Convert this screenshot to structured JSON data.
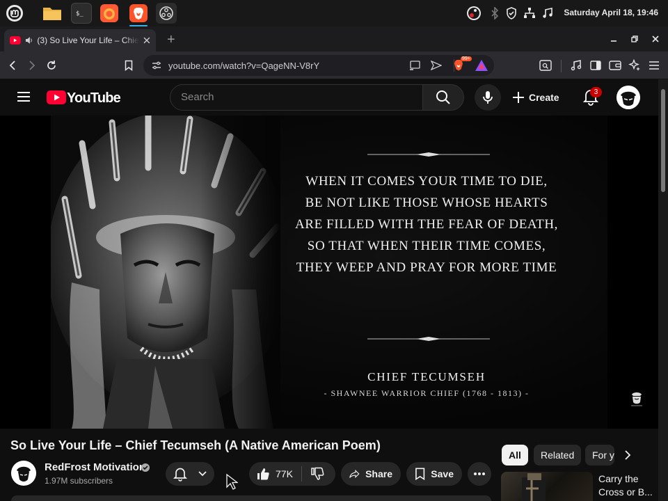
{
  "system_panel": {
    "clock": "Saturday April 18, 19:46",
    "dock_apps": [
      "mint-menu",
      "files",
      "terminal",
      "firefox",
      "brave",
      "obs"
    ]
  },
  "tab": {
    "title": "(3) So Live Your Life – Chief Tecumseh (A Native American Poem)",
    "new_tab": "+"
  },
  "toolbar": {
    "url": "youtube.com/watch?v=QageNN-V8rY",
    "brave_shield_count": "99+"
  },
  "youtube": {
    "logo_text": "YouTube",
    "search_placeholder": "Search",
    "create_label": "Create",
    "notification_count": "3"
  },
  "video_frame": {
    "quote_lines": [
      "WHEN IT COMES YOUR TIME TO DIE,",
      "BE NOT LIKE THOSE WHOSE HEARTS",
      "ARE FILLED WITH THE FEAR OF DEATH,",
      "SO THAT WHEN THEIR TIME COMES,",
      "THEY WEEP AND PRAY FOR MORE TIME"
    ],
    "author": "CHIEF TECUMSEH",
    "author_subtitle": "- SHAWNEE WARRIOR CHIEF (1768 - 1813) -"
  },
  "video": {
    "title": "So Live Your Life – Chief Tecumseh (A Native American Poem)",
    "channel_name": "RedFrost Motivation",
    "subscribers": "1.97M subscribers",
    "likes": "77K",
    "share_label": "Share",
    "save_label": "Save"
  },
  "sidebar": {
    "chips": [
      "All",
      "Related",
      "For you"
    ],
    "recommendation_title": "Carry the Cross or B..."
  },
  "colors": {
    "youtube_red": "#ff0033",
    "page_bg": "#0f0f0f",
    "chip_active_bg": "#f1f1f1",
    "notification_badge": "#cc0000"
  }
}
